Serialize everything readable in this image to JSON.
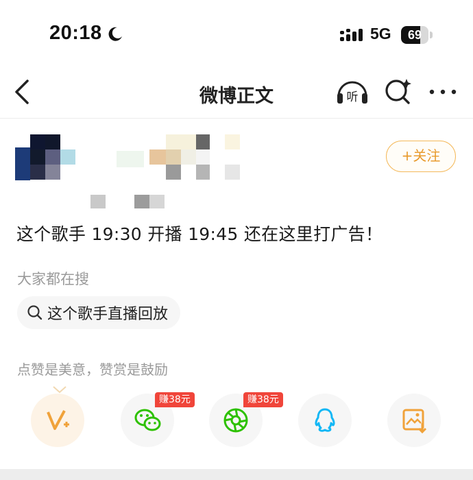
{
  "status_bar": {
    "time": "20:18",
    "network": "5G",
    "battery": "69",
    "battery_level": 0.69,
    "icons": [
      "moon-icon",
      "signal-icon",
      "battery-icon"
    ]
  },
  "nav": {
    "title": "微博正文",
    "listen_label": "听",
    "icons": [
      "back-icon",
      "listen-icon",
      "ai-search-icon",
      "more-icon"
    ]
  },
  "author": {
    "follow_label": "+关注"
  },
  "post": {
    "text": "这个歌手 19:30 开播 19:45 还在这里打广告！"
  },
  "hot_search": {
    "label": "大家都在搜",
    "query": "这个歌手直播回放"
  },
  "reward": {
    "text": "点赞是美意，赞赏是鼓励"
  },
  "share": {
    "items": [
      {
        "name": "v-plus",
        "icon": "v-plus-icon"
      },
      {
        "name": "wechat",
        "icon": "wechat-icon",
        "badge": "赚38元"
      },
      {
        "name": "moments",
        "icon": "moments-icon",
        "badge": "赚38元"
      },
      {
        "name": "qq",
        "icon": "qq-icon"
      },
      {
        "name": "save-image",
        "icon": "save-image-icon"
      }
    ]
  },
  "colors": {
    "accent_orange": "#e89a2c",
    "badge_red": "#f0453a",
    "wechat_green": "#2dc100",
    "qq_blue": "#12b7f5"
  }
}
